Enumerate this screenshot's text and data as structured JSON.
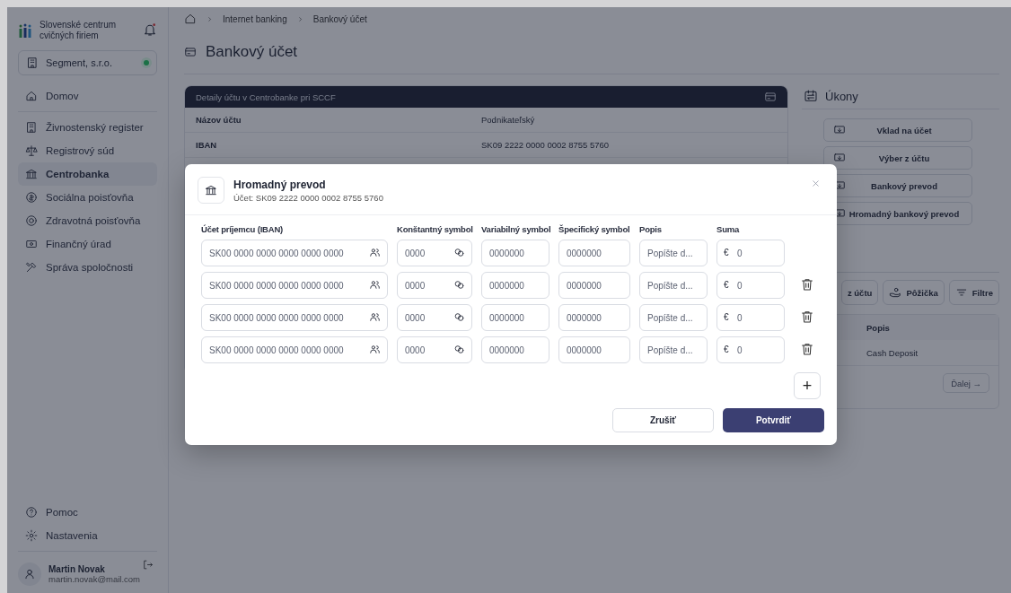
{
  "sidebar": {
    "org": "Slovenské centrum cvičných firiem",
    "company": {
      "name": "Segment, s.r.o.",
      "online": true
    },
    "items": [
      {
        "label": "Domov",
        "selected": false
      },
      {
        "label": "Živnostenský register",
        "selected": false
      },
      {
        "label": "Registrový súd",
        "selected": false
      },
      {
        "label": "Centrobanka",
        "selected": true
      },
      {
        "label": "Sociálna poisťovňa",
        "selected": false
      },
      {
        "label": "Zdravotná poisťovňa",
        "selected": false
      },
      {
        "label": "Finančný úrad",
        "selected": false
      },
      {
        "label": "Správa spoločnosti",
        "selected": false
      }
    ],
    "footer_items": [
      {
        "label": "Pomoc"
      },
      {
        "label": "Nastavenia"
      }
    ],
    "user": {
      "name": "Martin Novak",
      "email": "martin.novak@mail.com"
    }
  },
  "breadcrumb": [
    "Internet banking",
    "Bankový účet"
  ],
  "page_title": "Bankový účet",
  "account_card": {
    "title": "Detaily účtu v Centrobanke pri SCCF",
    "rows": [
      {
        "label": "Názov účtu",
        "value": "Podnikateľský"
      },
      {
        "label": "IBAN",
        "value": "SK09 2222 0000 0002 8755 5760"
      }
    ]
  },
  "actions": {
    "title": "Úkony",
    "buttons": [
      "Vklad na účet",
      "Výber z účtu",
      "Bankový prevod",
      "Hromadný bankový prevod"
    ]
  },
  "transactions": {
    "buttons": [
      {
        "label": "z účtu",
        "kind": "plain"
      },
      {
        "label": "Pôžička",
        "kind": "loan"
      },
      {
        "label": "Filtre",
        "kind": "filter"
      }
    ],
    "column": "Popis",
    "rows": [
      "Cash Deposit"
    ],
    "next": "Ďalej →"
  },
  "modal": {
    "title": "Hromadný prevod",
    "subtitle": "Účet: SK09 2222 0000 0002 8755 5760",
    "columns": [
      "Účet príjemcu (IBAN)",
      "Konštantný symbol",
      "Variabilný symbol",
      "Špecifický symbol",
      "Popis",
      "Suma"
    ],
    "rows": [
      {
        "iban": {
          "placeholder": "SK00 0000 0000 0000 0000 0000"
        },
        "constant": {
          "placeholder": "0000"
        },
        "variable": {
          "placeholder": "0000000"
        },
        "specific": {
          "placeholder": "0000000"
        },
        "description": {
          "placeholder": "Popíšte d..."
        },
        "currency": "€",
        "amount": {
          "placeholder": "0"
        },
        "deletable": false
      },
      {
        "iban": {
          "placeholder": "SK00 0000 0000 0000 0000 0000"
        },
        "constant": {
          "placeholder": "0000"
        },
        "variable": {
          "placeholder": "0000000"
        },
        "specific": {
          "placeholder": "0000000"
        },
        "description": {
          "placeholder": "Popíšte d..."
        },
        "currency": "€",
        "amount": {
          "placeholder": "0"
        },
        "deletable": true
      },
      {
        "iban": {
          "placeholder": "SK00 0000 0000 0000 0000 0000"
        },
        "constant": {
          "placeholder": "0000"
        },
        "variable": {
          "placeholder": "0000000"
        },
        "specific": {
          "placeholder": "0000000"
        },
        "description": {
          "placeholder": "Popíšte d..."
        },
        "currency": "€",
        "amount": {
          "placeholder": "0"
        },
        "deletable": true
      },
      {
        "iban": {
          "placeholder": "SK00 0000 0000 0000 0000 0000"
        },
        "constant": {
          "placeholder": "0000"
        },
        "variable": {
          "placeholder": "0000000"
        },
        "specific": {
          "placeholder": "0000000"
        },
        "description": {
          "placeholder": "Popíšte d..."
        },
        "currency": "€",
        "amount": {
          "placeholder": "0"
        },
        "deletable": true
      }
    ],
    "add": "+",
    "cancel": "Zrušiť",
    "confirm": "Potvrdiť"
  }
}
